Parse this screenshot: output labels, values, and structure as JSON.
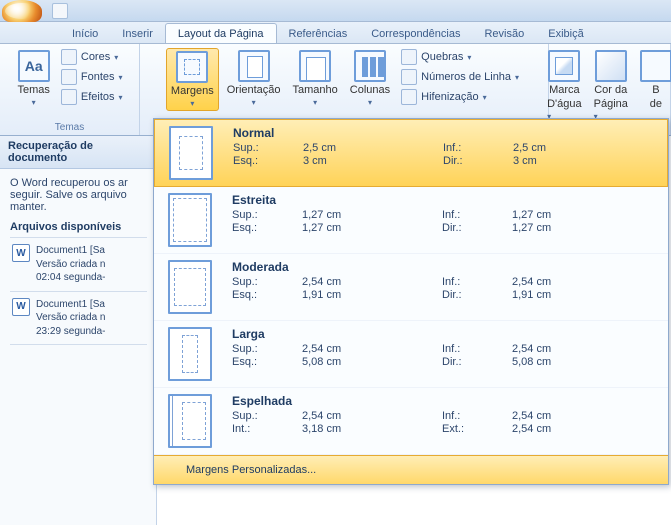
{
  "tabs": {
    "inicio": "Início",
    "inserir": "Inserir",
    "layout": "Layout da Página",
    "referencias": "Referências",
    "correspondencias": "Correspondências",
    "revisao": "Revisão",
    "exibicao": "Exibiçã"
  },
  "ribbon": {
    "temas": {
      "label": "Temas",
      "group": "Temas",
      "cores": "Cores",
      "fontes": "Fontes",
      "efeitos": "Efeitos"
    },
    "pagesetup": {
      "margens": "Margens",
      "orientacao": "Orientação",
      "tamanho": "Tamanho",
      "colunas": "Colunas",
      "quebras": "Quebras",
      "numlinha": "Números de Linha",
      "hifen": "Hifenização"
    },
    "background": {
      "marca_l1": "Marca",
      "marca_l2": "D'água",
      "cor_l1": "Cor da",
      "cor_l2": "Página",
      "bordas_l1": "B",
      "bordas_l2": "de"
    }
  },
  "recovery": {
    "header": "Recuperação de documento",
    "msg_l1": "O Word recuperou os ar",
    "msg_l2": "seguir. Salve os arquivo",
    "msg_l3": "manter.",
    "avail": "Arquivos disponíveis",
    "files": [
      {
        "name": "Document1  [Sa",
        "ver": "Versão criada n",
        "time": "02:04 segunda-"
      },
      {
        "name": "Document1  [Sa",
        "ver": "Versão criada n",
        "time": "23:29 segunda-"
      }
    ]
  },
  "dropdown": {
    "labels": {
      "sup": "Sup.:",
      "inf": "Inf.:",
      "esq": "Esq.:",
      "dir": "Dir.:",
      "int": "Int.:",
      "ext": "Ext.:"
    },
    "options": [
      {
        "title": "Normal",
        "l1": "Sup.:",
        "v1": "2,5 cm",
        "l2": "Inf.:",
        "v2": "2,5 cm",
        "l3": "Esq.:",
        "v3": "3 cm",
        "l4": "Dir.:",
        "v4": "3 cm",
        "iconcls": "m-normal"
      },
      {
        "title": "Estreita",
        "l1": "Sup.:",
        "v1": "1,27 cm",
        "l2": "Inf.:",
        "v2": "1,27 cm",
        "l3": "Esq.:",
        "v3": "1,27 cm",
        "l4": "Dir.:",
        "v4": "1,27 cm",
        "iconcls": "m-estreita"
      },
      {
        "title": "Moderada",
        "l1": "Sup.:",
        "v1": "2,54 cm",
        "l2": "Inf.:",
        "v2": "2,54 cm",
        "l3": "Esq.:",
        "v3": "1,91 cm",
        "l4": "Dir.:",
        "v4": "1,91 cm",
        "iconcls": "m-moderada"
      },
      {
        "title": "Larga",
        "l1": "Sup.:",
        "v1": "2,54 cm",
        "l2": "Inf.:",
        "v2": "2,54 cm",
        "l3": "Esq.:",
        "v3": "5,08 cm",
        "l4": "Dir.:",
        "v4": "5,08 cm",
        "iconcls": "m-larga"
      },
      {
        "title": "Espelhada",
        "l1": "Sup.:",
        "v1": "2,54 cm",
        "l2": "Inf.:",
        "v2": "2,54 cm",
        "l3": "Int.:",
        "v3": "3,18 cm",
        "l4": "Ext.:",
        "v4": "2,54 cm",
        "iconcls": "m-espelhada"
      }
    ],
    "custom": "Margens Personalizadas..."
  }
}
